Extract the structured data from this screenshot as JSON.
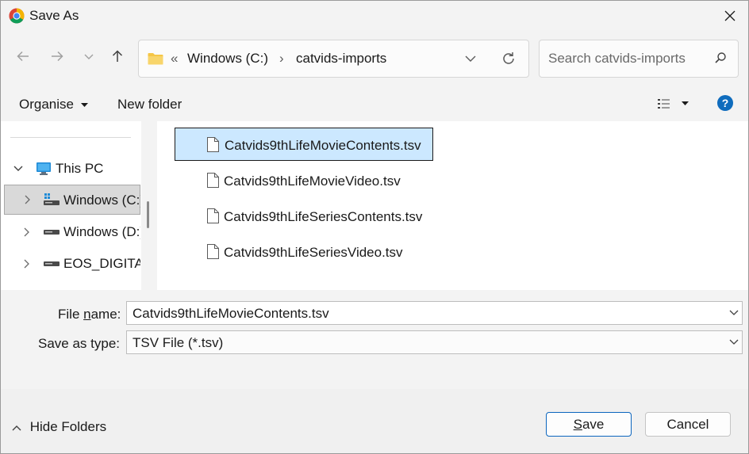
{
  "window": {
    "title": "Save As"
  },
  "nav": {
    "path": [
      "Windows (C:)",
      "catvids-imports"
    ],
    "overflow_glyph": "«",
    "separator_glyph": "›"
  },
  "search": {
    "placeholder": "Search catvids-imports"
  },
  "toolbar": {
    "organise_label": "Organise",
    "new_folder_label": "New folder"
  },
  "tree": {
    "root": "This PC",
    "items": [
      {
        "label": "Windows (C:)",
        "selected": true
      },
      {
        "label": "Windows (D:)",
        "selected": false
      },
      {
        "label": "EOS_DIGITAL",
        "selected": false
      }
    ]
  },
  "files": [
    {
      "name": "Catvids9thLifeMovieContents.tsv",
      "selected": true
    },
    {
      "name": "Catvids9thLifeMovieVideo.tsv",
      "selected": false
    },
    {
      "name": "Catvids9thLifeSeriesContents.tsv",
      "selected": false
    },
    {
      "name": "Catvids9thLifeSeriesVideo.tsv",
      "selected": false
    }
  ],
  "form": {
    "file_name_label_pre": "File ",
    "file_name_label_underlined": "n",
    "file_name_label_post": "ame:",
    "file_name_value": "Catvids9thLifeMovieContents.tsv",
    "save_type_label": "Save as type:",
    "save_type_value": "TSV File (*.tsv)"
  },
  "footer": {
    "hide_folders_label": "Hide Folders",
    "save_label_underlined": "S",
    "save_label_rest": "ave",
    "cancel_label": "Cancel"
  },
  "colors": {
    "accent": "#0a64bd",
    "selection": "#cce8ff",
    "help": "#0f6cbd",
    "folder": "#f5c646"
  },
  "icons": {
    "title": "chrome-icon",
    "close": "close-icon",
    "back": "back-arrow-icon",
    "forward": "forward-arrow-icon",
    "recent": "chevron-down-icon",
    "up": "up-arrow-icon",
    "folder": "folder-icon",
    "refresh": "refresh-icon",
    "search": "search-icon",
    "view": "view-options-icon",
    "help": "help-icon",
    "pc": "computer-icon",
    "drive": "drive-icon",
    "file": "file-icon"
  }
}
